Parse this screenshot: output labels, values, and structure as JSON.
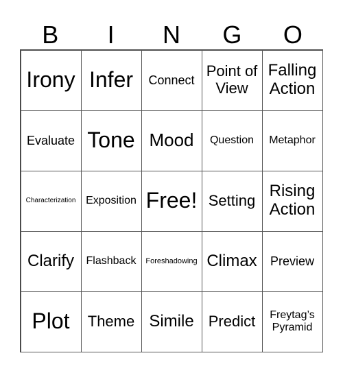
{
  "header": [
    "B",
    "I",
    "N",
    "G",
    "O"
  ],
  "cells": [
    [
      "Irony",
      "Infer",
      "Connect",
      "Point of View",
      "Falling Action"
    ],
    [
      "Evaluate",
      "Tone",
      "Mood",
      "Question",
      "Metaphor"
    ],
    [
      "Characterization",
      "Exposition",
      "Free!",
      "Setting",
      "Rising Action"
    ],
    [
      "Clarify",
      "Flashback",
      "Foreshadowing",
      "Climax",
      "Preview"
    ],
    [
      "Plot",
      "Theme",
      "Simile",
      "Predict",
      "Freytag’s Pyramid"
    ]
  ]
}
